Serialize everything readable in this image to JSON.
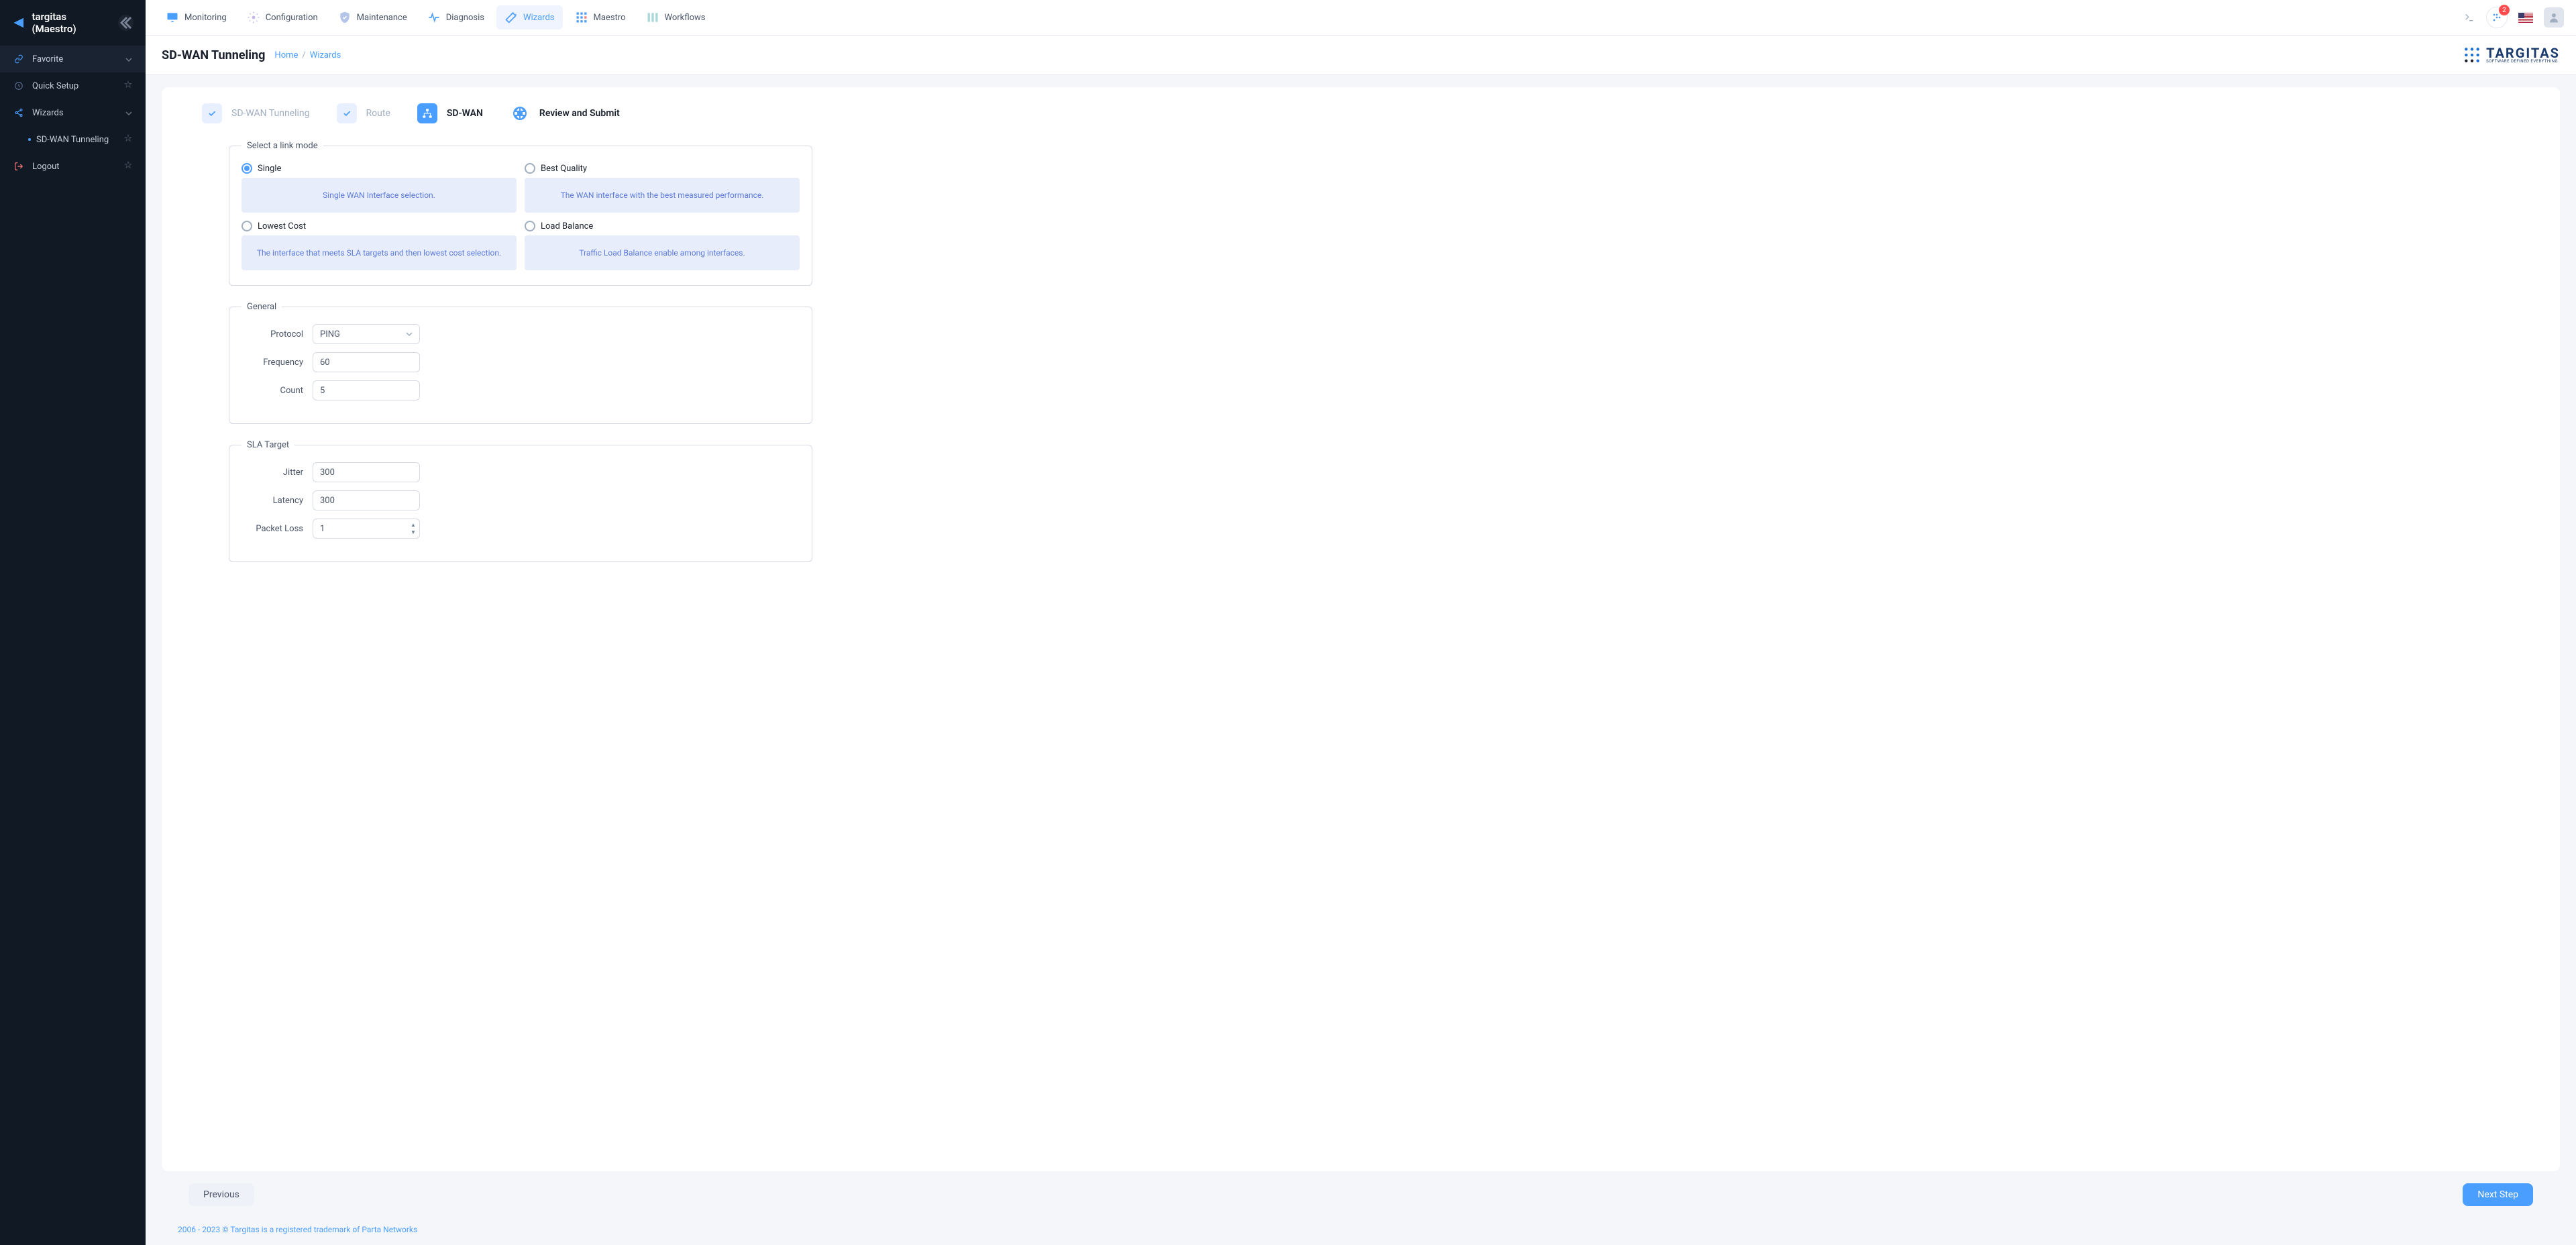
{
  "brand": {
    "name": "targitas (Maestro)"
  },
  "sidebar": {
    "items": [
      {
        "label": "Favorite",
        "icon": "link"
      },
      {
        "label": "Quick Setup",
        "icon": "clock"
      },
      {
        "label": "Wizards",
        "icon": "share"
      },
      {
        "label": "SD-WAN Tunneling",
        "sub": true
      },
      {
        "label": "Logout",
        "icon": "logout"
      }
    ]
  },
  "topbar": {
    "tabs": [
      {
        "label": "Monitoring"
      },
      {
        "label": "Configuration"
      },
      {
        "label": "Maintenance"
      },
      {
        "label": "Diagnosis"
      },
      {
        "label": "Wizards",
        "active": true
      },
      {
        "label": "Maestro"
      },
      {
        "label": "Workflows"
      }
    ],
    "notif_count": "2"
  },
  "page": {
    "title": "SD-WAN Tunneling",
    "crumbs": [
      {
        "label": "Home"
      },
      {
        "label": "Wizards"
      }
    ]
  },
  "logo": {
    "text1": "TARGITAS",
    "text2": "SOFTWARE DEFINED EVERYTHING"
  },
  "steps": [
    {
      "label": "SD-WAN Tunneling",
      "state": "done"
    },
    {
      "label": "Route",
      "state": "done"
    },
    {
      "label": "SD-WAN",
      "state": "active"
    },
    {
      "label": "Review and Submit",
      "state": "inactive"
    }
  ],
  "linkmode": {
    "legend": "Select a link mode",
    "opts": [
      {
        "label": "Single",
        "desc": "Single WAN Interface selection.",
        "selected": true
      },
      {
        "label": "Best Quality",
        "desc": "The WAN interface with the best measured performance."
      },
      {
        "label": "Lowest Cost",
        "desc": "The interface that meets SLA targets and then lowest cost selection."
      },
      {
        "label": "Load Balance",
        "desc": "Traffic Load Balance enable among interfaces."
      }
    ]
  },
  "general": {
    "legend": "General",
    "protocol_label": "Protocol",
    "protocol_value": "PING",
    "frequency_label": "Frequency",
    "frequency_value": "60",
    "count_label": "Count",
    "count_value": "5"
  },
  "sla": {
    "legend": "SLA Target",
    "jitter_label": "Jitter",
    "jitter_value": "300",
    "latency_label": "Latency",
    "latency_value": "300",
    "packetloss_label": "Packet Loss",
    "packetloss_value": "1"
  },
  "buttons": {
    "prev": "Previous",
    "next": "Next Step"
  },
  "footer": "2006 - 2023 © Targitas is a registered trademark of Parta Networks"
}
